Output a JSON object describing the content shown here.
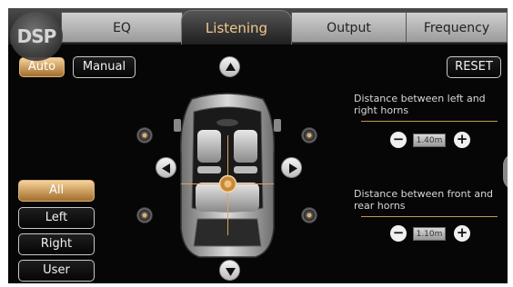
{
  "logo": "DSP",
  "tabs": [
    {
      "label": "EQ"
    },
    {
      "label": "Listening"
    },
    {
      "label": "Output"
    },
    {
      "label": "Frequency"
    }
  ],
  "mode": {
    "auto": "Auto",
    "manual": "Manual",
    "selected": "Auto"
  },
  "reset": "RESET",
  "seat_buttons": [
    {
      "label": "All",
      "selected": true
    },
    {
      "label": "Left",
      "selected": false
    },
    {
      "label": "Right",
      "selected": false
    },
    {
      "label": "User",
      "selected": false
    }
  ],
  "distance_lr": {
    "label": "Distance between left and right horns",
    "value": "1.40m",
    "minus": "−",
    "plus": "+"
  },
  "distance_fr": {
    "label": "Distance between front and rear horns",
    "value": "1.10m",
    "minus": "−",
    "plus": "+"
  },
  "colors": {
    "accent": "#f0c98c",
    "active_button": "#d9a560",
    "rule": "#c49652"
  },
  "icons": [
    "arrow-up-icon",
    "arrow-down-icon",
    "arrow-left-icon",
    "arrow-right-icon",
    "speaker-icon",
    "listening-position-icon",
    "car-top-view"
  ]
}
